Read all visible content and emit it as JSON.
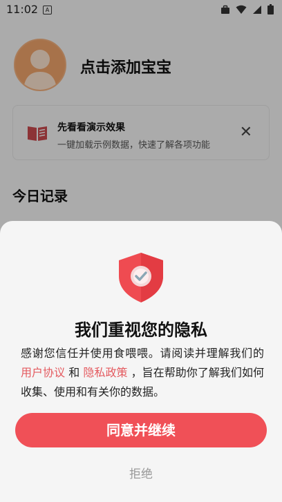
{
  "status_bar": {
    "time": "11:02",
    "a_label": "A"
  },
  "profile": {
    "title": "点击添加宝宝"
  },
  "demo_card": {
    "title": "先看看演示效果",
    "subtitle": "一键加载示例数据，快速了解各项功能",
    "close": "✕"
  },
  "today": {
    "title": "今日记录"
  },
  "privacy_dialog": {
    "title": "我们重视您的隐私",
    "body_1": "感谢您信任并使用食喂喂。请阅读并理解我们的",
    "user_agreement": "用户协议",
    "and": "和",
    "privacy_policy": "隐私政策",
    "body_2": "，旨在帮助你了解我们如何收集、使用和有关你的数据。",
    "agree_label": "同意并继续",
    "reject_label": "拒绝"
  },
  "colors": {
    "accent": "#f05057",
    "link": "#e45a5f",
    "avatar": "#f0a46b",
    "book_icon": "#c94a4e"
  }
}
